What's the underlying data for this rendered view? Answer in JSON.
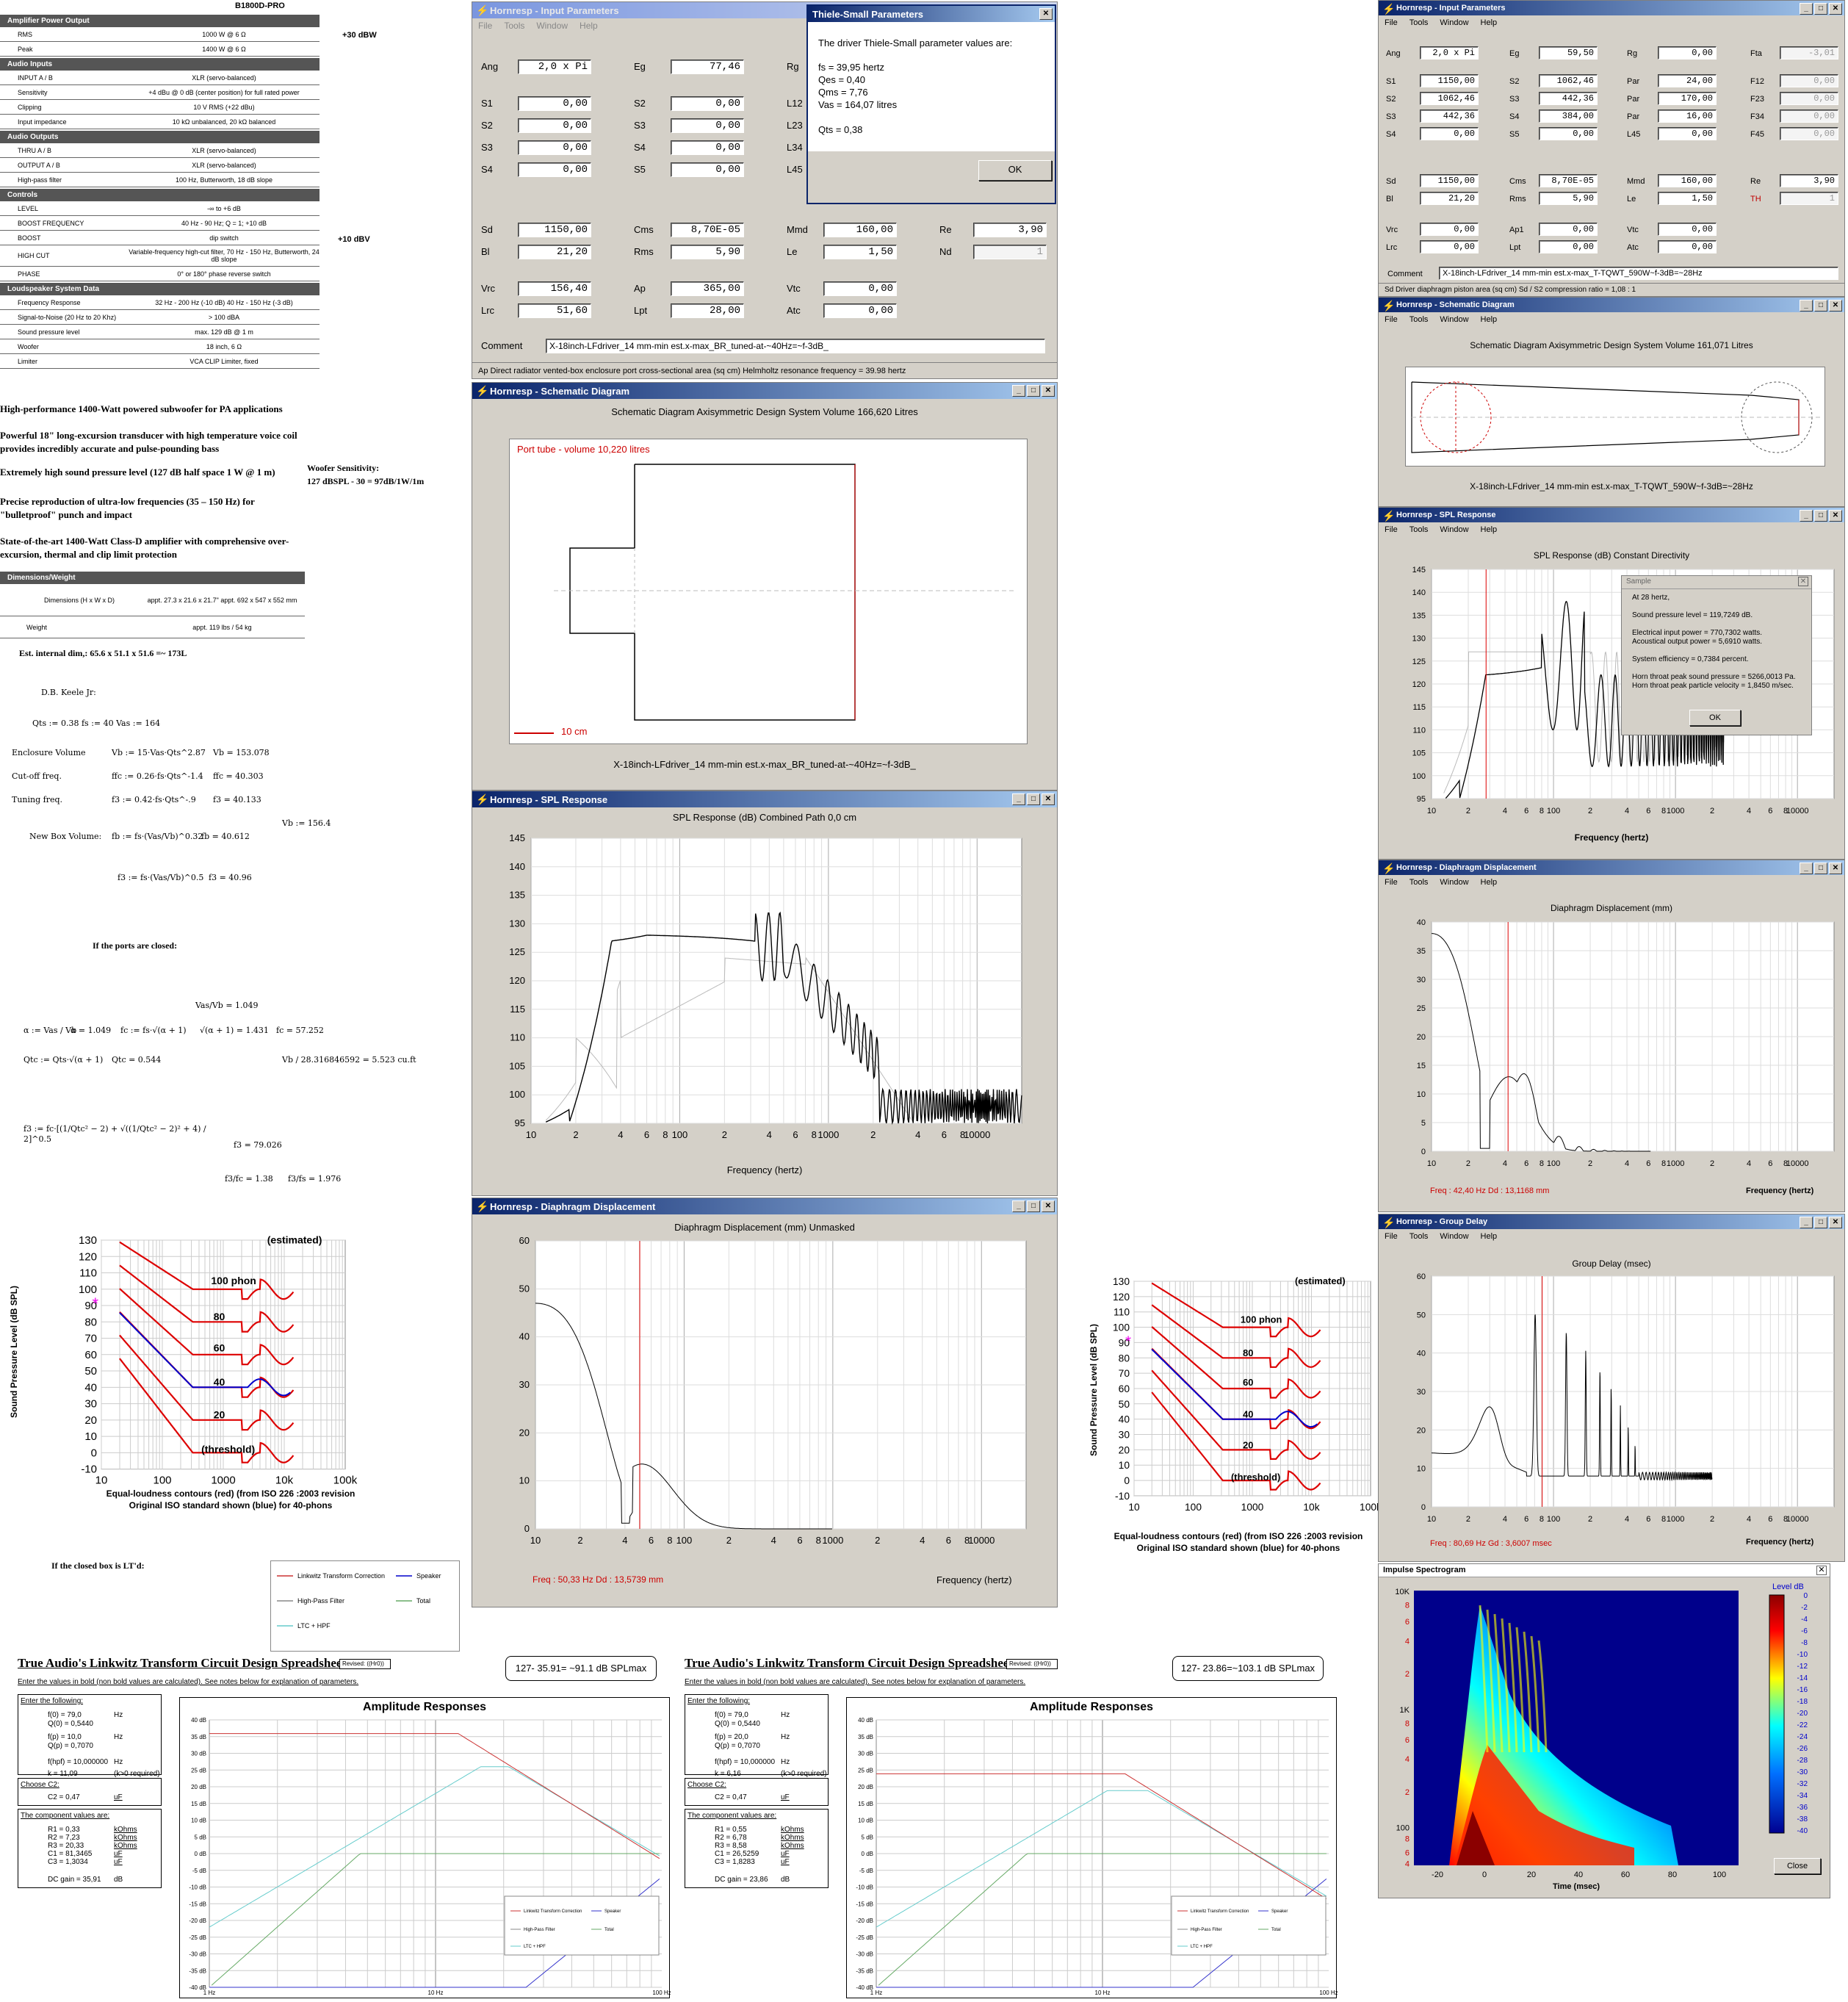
{
  "spec_sheet": {
    "model": "B1800D-PRO",
    "sections": [
      {
        "title": "Amplifier Power Output",
        "rows": [
          [
            "RMS",
            "1000 W @ 6 Ω"
          ],
          [
            "Peak",
            "1400 W @ 6 Ω"
          ]
        ]
      },
      {
        "title": "Audio Inputs",
        "rows": [
          [
            "INPUT A / B",
            "XLR (servo-balanced)"
          ],
          [
            "Sensitivity",
            "+4 dBu @ 0 dB (center position) for full rated power"
          ],
          [
            "Clipping",
            "10 V RMS (+22 dBu)"
          ],
          [
            "Input impedance",
            "10 kΩ unbalanced, 20 kΩ balanced"
          ]
        ]
      },
      {
        "title": "Audio Outputs",
        "rows": [
          [
            "THRU A / B",
            "XLR (servo-balanced)"
          ],
          [
            "OUTPUT A / B",
            "XLR (servo-balanced)"
          ],
          [
            "High-pass filter",
            "100 Hz, Butterworth, 18 dB slope"
          ]
        ]
      },
      {
        "title": "Controls",
        "rows": [
          [
            "LEVEL",
            "-∞ to +6 dB"
          ],
          [
            "BOOST FREQUENCY",
            "40 Hz - 90 Hz; Q = 1; +10 dB"
          ],
          [
            "BOOST",
            "dip switch"
          ],
          [
            "HIGH CUT",
            "Variable-frequency high-cut filter, 70 Hz - 150 Hz, Butterworth, 24 dB slope"
          ],
          [
            "PHASE",
            "0° or 180° phase reverse switch"
          ]
        ]
      },
      {
        "title": "Loudspeaker System Data",
        "rows": [
          [
            "Frequency Response",
            "32 Hz - 200 Hz (-10 dB) 40 Hz - 150 Hz (-3 dB)"
          ],
          [
            "Signal-to-Noise (20 Hz to 20 Khz)",
            "> 100 dBA"
          ],
          [
            "Sound pressure level",
            "max. 129 dB @ 1 m"
          ],
          [
            "Woofer",
            "18 inch, 6 Ω"
          ],
          [
            "Limiter",
            "VCA CLIP Limiter, fixed"
          ]
        ]
      }
    ],
    "dim_title": "Dimensions/Weight",
    "dim_rows": [
      [
        "Dimensions (H x W x D)",
        "appt. 27.3 x 21.6 x 21.7\" appt. 692 x 547 x 552 mm"
      ],
      [
        "Weight",
        "appt. 119 lbs / 54 kg"
      ]
    ],
    "note_30dbw": "+30 dBW",
    "note_10dbv": "+10 dBV",
    "features": [
      "High-performance 1400-Watt powered subwoofer for PA applications",
      "Powerful 18\" long-excursion transducer with high temperature voice coil provides incredibly accurate and pulse-pounding bass",
      "Extremely high sound pressure level (127 dB half space 1 W @ 1 m)",
      "Precise reproduction of ultra-low frequencies (35 – 150 Hz) for \"bulletproof\" punch and impact",
      "State-of-the-art 1400-Watt Class-D amplifier with comprehensive over-excursion, thermal and clip limit protection"
    ],
    "woofer_sens": "Woofer Sensitivity:",
    "woofer_sens2": "127 dBSPL - 30 = 97dB/1W/1m",
    "est_internal": "Est. internal dim,: 65.6 x 51.1 x 51.6 =~ 173L"
  },
  "math": {
    "keele": "D.B. Keele Jr:",
    "params": "Qts := 0.38        fs := 40        Vas := 164",
    "enclosure_label": "Enclosure Volume",
    "enclosure_expr": "Vb := 15·Vas·Qts^2.87",
    "enclosure_val": "Vb = 153.078",
    "cutoff_label": "Cut-off freq.",
    "cutoff_expr": "ffc := 0.26·fs·Qts^-1.4",
    "cutoff_val": "ffc = 40.303",
    "tuning_label": "Tuning freq.",
    "tuning_expr": "f3 := 0.42·fs·Qts^-.9",
    "tuning_val": "f3 = 40.133",
    "newbox_label": "New Box Volume:",
    "newbox_expr": "fb := fs·(Vas/Vb)^0.32",
    "newbox_val": "fb = 40.612",
    "vb_val": "Vb := 156.4",
    "f3b_expr": "f3 := fs·(Vas/Vb)^0.5",
    "f3b_val": "f3 = 40.96",
    "ports_closed": "If the ports are closed:",
    "alpha_expr": "α := Vas / Vb",
    "alpha_val": "α = 1.049",
    "ratio_val": "Vas/Vb = 1.049",
    "fc_expr": "fc := fs·√(α + 1)",
    "sqrt_val": "√(α + 1) = 1.431",
    "fc_val": "fc = 57.252",
    "qtc_expr": "Qtc := Qts·√(α + 1)",
    "qtc_val": "Qtc = 0.544",
    "cuft": "Vb / 28.316846592 = 5.523  cu.ft",
    "f3c_expr": "f3 := fc·[(1/Qtc² − 2) + √((1/Qtc² − 2)² + 4) / 2]^0.5",
    "f3c_val": "f3 = 79.026",
    "ratio1": "f3/fc = 1.38",
    "ratio2": "f3/fs = 1.976",
    "closed_ltd": "If the closed box is LT'd:"
  },
  "iso_chart": {
    "ylabel": "Sound Pressure Level (dB SPL)",
    "yticks": [
      "130",
      "120",
      "110",
      "100",
      "90",
      "80",
      "70",
      "60",
      "50",
      "40",
      "30",
      "20",
      "10",
      "0",
      "-10"
    ],
    "xticks": [
      "10",
      "100",
      "1000",
      "10k",
      "100k"
    ],
    "labels": [
      "(estimated)",
      "100 phon",
      "80",
      "60",
      "40",
      "20",
      "(threshold)"
    ],
    "caption1": "Equal-loudness contours (red) (from ISO 226 :2003 revision",
    "caption2": "Original ISO standard shown (blue) for 40-phons"
  },
  "legend_small": {
    "items": [
      "Linkwitz Transform Correction",
      "Speaker",
      "High-Pass Filter",
      "Total",
      "LTC + HPF"
    ]
  },
  "input_params": {
    "title": "Hornresp - Input Parameters",
    "menu": [
      "File",
      "Tools",
      "Window",
      "Help"
    ],
    "fields": {
      "Ang": "2,0 x Pi",
      "Eg": "77,46",
      "S1": "0,00",
      "S2": "0,00",
      "S3": "0,00",
      "S4": "0,00",
      "S2b": "0,00",
      "S3b": "0,00",
      "S4b": "0,00",
      "S5": "0,00",
      "Sd": "1150,00",
      "Bl": "21,20",
      "Cms": "8,70E-05",
      "Rms": "5,90",
      "Mmd": "160,00",
      "Le": "1,50",
      "Re": "3,90",
      "Nd": "1",
      "Vrc": "156,40",
      "Lrc": "51,60",
      "Ap": "365,00",
      "Lpt": "28,00",
      "Vtc": "0,00",
      "Atc": "0,00"
    },
    "labels": [
      "Ang",
      "Eg",
      "Rg",
      "S1",
      "S2",
      "L12",
      "S2",
      "S3",
      "L23",
      "S3",
      "S4",
      "L34",
      "S4",
      "S5",
      "L45",
      "Sd",
      "Cms",
      "Mmd",
      "Re",
      "Bl",
      "Rms",
      "Le",
      "Nd",
      "Vrc",
      "Ap",
      "Vtc",
      "Lrc",
      "Lpt",
      "Atc"
    ],
    "comment_label": "Comment",
    "comment": "X-18inch-LFdriver_14 mm-min est.x-max_BR_tuned-at-~40Hz=~f-3dB_",
    "status": "Ap   Direct radiator vented-box enclosure port cross-sectional area  (sq cm)   Helmholtz resonance frequency = 39.98 hertz"
  },
  "ts_dialog": {
    "title": "Thiele-Small Parameters",
    "intro": "The driver Thiele-Small parameter values are:",
    "lines": [
      "fs = 39,95 hertz",
      "Qes = 0,40",
      "Qms = 7,76",
      "Vas = 164,07 litres",
      "",
      "Qts = 0,38"
    ],
    "ok": "OK"
  },
  "schematic1": {
    "title": "Hornresp - Schematic Diagram",
    "header": "Schematic Diagram   Axisymmetric Design   System Volume 166,620 Litres",
    "port_label": "Port tube - volume 10,220 litres",
    "scale": "10 cm",
    "caption": "X-18inch-LFdriver_14 mm-min est.x-max_BR_tuned-at-~40Hz=~f-3dB_"
  },
  "spl1": {
    "title": "Hornresp - SPL Response",
    "header": "SPL Response (dB)   Combined   Path 0,0 cm",
    "yticks": [
      "145",
      "140",
      "135",
      "130",
      "125",
      "120",
      "115",
      "110",
      "105",
      "100",
      "95"
    ],
    "xticks": [
      "10",
      "2",
      "4",
      "6",
      "8",
      "100",
      "2",
      "4",
      "6",
      "8",
      "1000",
      "2",
      "4",
      "6",
      "8",
      "10000",
      "2"
    ],
    "xlabel": "Frequency (hertz)"
  },
  "disp1": {
    "title": "Hornresp - Diaphragm Displacement",
    "header": "Diaphragm Displacement (mm)   Unmasked",
    "yticks": [
      "60",
      "50",
      "40",
      "30",
      "20",
      "10",
      "0"
    ],
    "xticks": [
      "10",
      "2",
      "4",
      "6",
      "8",
      "100",
      "2",
      "4",
      "6",
      "8",
      "1000",
      "2",
      "4",
      "6",
      "8",
      "10000",
      "2"
    ],
    "xlabel": "Frequency (hertz)",
    "readout": "Freq : 50,33 Hz      Dd : 13,5739 mm"
  },
  "iso_chart2": {
    "ylabel": "Sound Pressure Level (dB SPL)",
    "caption1": "Equal-loudness contours (red) (from ISO 226 :2003 revision",
    "caption2": "Original ISO standard shown (blue) for 40-phons"
  },
  "input_params2": {
    "title": "Hornresp - Input Parameters",
    "menu": [
      "File",
      "Tools",
      "Window",
      "Help"
    ],
    "fields": {
      "Ang": "2,0 x Pi",
      "Eg": "59,50",
      "Rg": "0,00",
      "Fta": "-3,01",
      "S1": "1150,00",
      "S2": "1062,46",
      "Par1": "24,00",
      "F12": "0,00",
      "S2b": "1062,46",
      "S3": "442,36",
      "Par2": "170,00",
      "F23": "0,00",
      "S3b": "442,36",
      "S4": "384,00",
      "Par3": "16,00",
      "F34": "0,00",
      "S4b": "0,00",
      "S5": "0,00",
      "L45": "0,00",
      "F45": "0,00",
      "Sd": "1150,00",
      "Cms": "8,70E-05",
      "Mmd": "160,00",
      "Re": "3,90",
      "Bl": "21,20",
      "Rms": "5,90",
      "Le": "1,50",
      "TH": "1",
      "Vrc": "0,00",
      "Ap1": "0,00",
      "Vtc": "0,00",
      "Lrc": "0,00",
      "Lpt": "0,00",
      "Atc": "0,00"
    },
    "comment_label": "Comment",
    "comment": "X-18inch-LFdriver_14 mm-min est.x-max_T-TQWT_590W~f-3dB=~28Hz",
    "status": "Sd   Driver diaphragm piston area (sq cm)   Sd / S2 compression ratio = 1,08 : 1"
  },
  "schematic2": {
    "title": "Hornresp - Schematic Diagram",
    "header": "Schematic Diagram   Axisymmetric Design   System Volume 161,071 Litres",
    "caption": "X-18inch-LFdriver_14 mm-min est.x-max_T-TQWT_590W~f-3dB=~28Hz"
  },
  "spl2": {
    "title": "Hornresp - SPL Response",
    "header": "SPL Response (dB)   Constant Directivity",
    "yticks": [
      "145",
      "140",
      "135",
      "130",
      "125",
      "120",
      "115",
      "110",
      "105",
      "100",
      "95"
    ],
    "xlabel": "Frequency (hertz)",
    "sample": {
      "title": "Sample",
      "lines": [
        "At 28 hertz,",
        "",
        "Sound pressure level = 119,7249 dB.",
        "",
        "Electrical input power = 770,7302 watts.",
        "Acoustical output power = 5,6910 watts.",
        "",
        "System efficiency = 0,7384 percent.",
        "",
        "Horn throat peak sound pressure = 5266,0013 Pa.",
        "Horn throat peak particle velocity = 1,8450 m/sec."
      ],
      "ok": "OK"
    }
  },
  "disp2": {
    "title": "Hornresp - Diaphragm Displacement",
    "header": "Diaphragm Displacement (mm)",
    "yticks": [
      "40",
      "35",
      "30",
      "25",
      "20",
      "15",
      "10",
      "5",
      "0"
    ],
    "xlabel": "Frequency (hertz)",
    "readout": "Freq : 42,40 Hz      Dd : 13,1168 mm"
  },
  "gd": {
    "title": "Hornresp - Group Delay",
    "header": "Group Delay (msec)",
    "yticks": [
      "60",
      "50",
      "40",
      "30",
      "20",
      "10",
      "0"
    ],
    "xlabel": "Frequency (hertz)",
    "readout": "Freq : 80,69 Hz      Gd : 3,6007 msec"
  },
  "spectro": {
    "title": "Impulse Spectrogram",
    "yticks": [
      "10K",
      "8",
      "6",
      "4",
      "2",
      "1K",
      "8",
      "6",
      "4",
      "2",
      "100",
      "8",
      "6",
      "4"
    ],
    "xticks": [
      "-20",
      "0",
      "20",
      "40",
      "60",
      "80",
      "100"
    ],
    "xlabel": "Time (msec)",
    "level_label": "Level   dB",
    "levels": [
      "0",
      "-2",
      "-4",
      "-6",
      "-8",
      "-10",
      "-12",
      "-14",
      "-16",
      "-18",
      "-20",
      "-22",
      "-24",
      "-26",
      "-28",
      "-30",
      "-32",
      "-34",
      "-36",
      "-38",
      "-40"
    ],
    "close": "Close"
  },
  "lt1": {
    "title": "True Audio's Linkwitz Transform Circuit Design Spreadsheet",
    "revised": "Revised: ((Hr0))",
    "spl": "127- 35.91= ~91.1 dB SPLmax",
    "intro": "Enter the values in bold (non bold values are calculated). See notes below for explanation of parameters.",
    "enter": "Enter the following:",
    "inputs": [
      [
        "f(0) = 79,0",
        "Hz"
      ],
      [
        "Q(0) = 0,5440",
        ""
      ],
      [
        "f(p) = 10,0",
        "Hz"
      ],
      [
        "Q(p) = 0,7070",
        ""
      ],
      [
        "f(hpf) = 10,000000",
        "Hz"
      ],
      [
        "k = 11,09",
        "(k>0 required)"
      ]
    ],
    "choose": "Choose C2:",
    "c2": "C2 = 0,47",
    "c2u": "uF",
    "comp_title": "The component values are:",
    "comps": [
      [
        "R1 = 0,33",
        "kOhms"
      ],
      [
        "R2 = 7,23",
        "kOhms"
      ],
      [
        "R3 = 20,33",
        "kOhms"
      ],
      [
        "C1 = 81,3465",
        "uF"
      ],
      [
        "C3 = 1,3034",
        "uF"
      ]
    ],
    "gain": "DC gain = 35,91",
    "gain_u": "dB",
    "chart_title": "Amplitude Responses"
  },
  "lt2": {
    "title": "True Audio's Linkwitz Transform Circuit Design Spreadsheet",
    "revised": "Revised: ((Hr0))",
    "spl": "127- 23.86=~103.1 dB SPLmax",
    "intro": "Enter the values in bold (non bold values are calculated). See notes below for explanation of parameters.",
    "enter": "Enter the following:",
    "inputs": [
      [
        "f(0) = 79,0",
        "Hz"
      ],
      [
        "Q(0) = 0,5440",
        ""
      ],
      [
        "f(p) = 20,0",
        "Hz"
      ],
      [
        "Q(p) = 0,7070",
        ""
      ],
      [
        "f(hpf) = 10,000000",
        "Hz"
      ],
      [
        "k = 6,16",
        "(k>0 required)"
      ]
    ],
    "choose": "Choose C2:",
    "c2": "C2 = 0,47",
    "c2u": "uF",
    "comp_title": "The component values are:",
    "comps": [
      [
        "R1 = 0,55",
        "kOhms"
      ],
      [
        "R2 = 6,78",
        "kOhms"
      ],
      [
        "R3 = 8,58",
        "kOhms"
      ],
      [
        "C1 = 26,5259",
        "uF"
      ],
      [
        "C3 = 1,8283",
        "uF"
      ]
    ],
    "gain": "DC gain = 23,86",
    "gain_u": "dB",
    "chart_title": "Amplitude Responses"
  },
  "lt_yticks": [
    "40 dB",
    "35 dB",
    "30 dB",
    "25 dB",
    "20 dB",
    "15 dB",
    "10 dB",
    "5 dB",
    "0 dB",
    "-5 dB",
    "-10 dB",
    "-15 dB",
    "-20 dB",
    "-25 dB",
    "-30 dB",
    "-35 dB",
    "-40 dB"
  ],
  "lt_xticks": [
    "1 Hz",
    "10 Hz",
    "100 Hz"
  ]
}
